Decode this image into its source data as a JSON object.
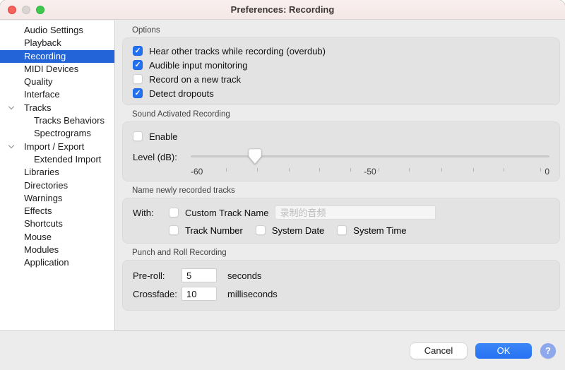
{
  "window": {
    "title": "Preferences: Recording"
  },
  "colors": {
    "selection_blue": "#2365d9",
    "checkbox_blue": "#2170f0",
    "ok_blue": "#2a7cf7",
    "help_blue": "#8ea8ee",
    "titlebar_pink": "#f7ecec",
    "panel_gray": "#ececec",
    "groupbox_gray": "#e3e3e3"
  },
  "sidebar": {
    "items": [
      {
        "label": "Audio Settings",
        "selected": false
      },
      {
        "label": "Playback",
        "selected": false
      },
      {
        "label": "Recording",
        "selected": true
      },
      {
        "label": "MIDI Devices",
        "selected": false
      },
      {
        "label": "Quality",
        "selected": false
      },
      {
        "label": "Interface",
        "selected": false
      },
      {
        "label": "Tracks",
        "selected": false,
        "chevron": true
      },
      {
        "label": "Tracks Behaviors",
        "selected": false,
        "indent": 1
      },
      {
        "label": "Spectrograms",
        "selected": false,
        "indent": 1
      },
      {
        "label": "Import / Export",
        "selected": false,
        "chevron": true
      },
      {
        "label": "Extended Import",
        "selected": false,
        "indent": 1
      },
      {
        "label": "Libraries",
        "selected": false
      },
      {
        "label": "Directories",
        "selected": false
      },
      {
        "label": "Warnings",
        "selected": false
      },
      {
        "label": "Effects",
        "selected": false
      },
      {
        "label": "Shortcuts",
        "selected": false
      },
      {
        "label": "Mouse",
        "selected": false
      },
      {
        "label": "Modules",
        "selected": false
      },
      {
        "label": "Application",
        "selected": false
      }
    ]
  },
  "options": {
    "title": "Options",
    "checkboxes": [
      {
        "label": "Hear other tracks while recording (overdub)",
        "checked": true
      },
      {
        "label": "Audible input monitoring",
        "checked": true
      },
      {
        "label": "Record on a new track",
        "checked": false
      },
      {
        "label": "Detect dropouts",
        "checked": true
      }
    ]
  },
  "sound": {
    "title": "Sound Activated Recording",
    "enable": {
      "label": "Enable",
      "checked": false
    },
    "level_label": "Level (dB):",
    "ruler_labels": [
      "-60",
      "-50",
      "0"
    ]
  },
  "naming": {
    "title": "Name newly recorded tracks",
    "with_label": "With:",
    "custom": {
      "label": "Custom Track Name",
      "checked": false
    },
    "placeholder": "录制的音频",
    "extras": [
      {
        "label": "Track Number",
        "checked": false
      },
      {
        "label": "System Date",
        "checked": false
      },
      {
        "label": "System Time",
        "checked": false
      }
    ]
  },
  "punch": {
    "title": "Punch and Roll Recording",
    "fields": [
      {
        "label": "Pre-roll:",
        "value": "5",
        "unit": "seconds"
      },
      {
        "label": "Crossfade:",
        "value": "10",
        "unit": "milliseconds"
      }
    ]
  },
  "footer": {
    "cancel": "Cancel",
    "ok": "OK",
    "help": "?"
  }
}
